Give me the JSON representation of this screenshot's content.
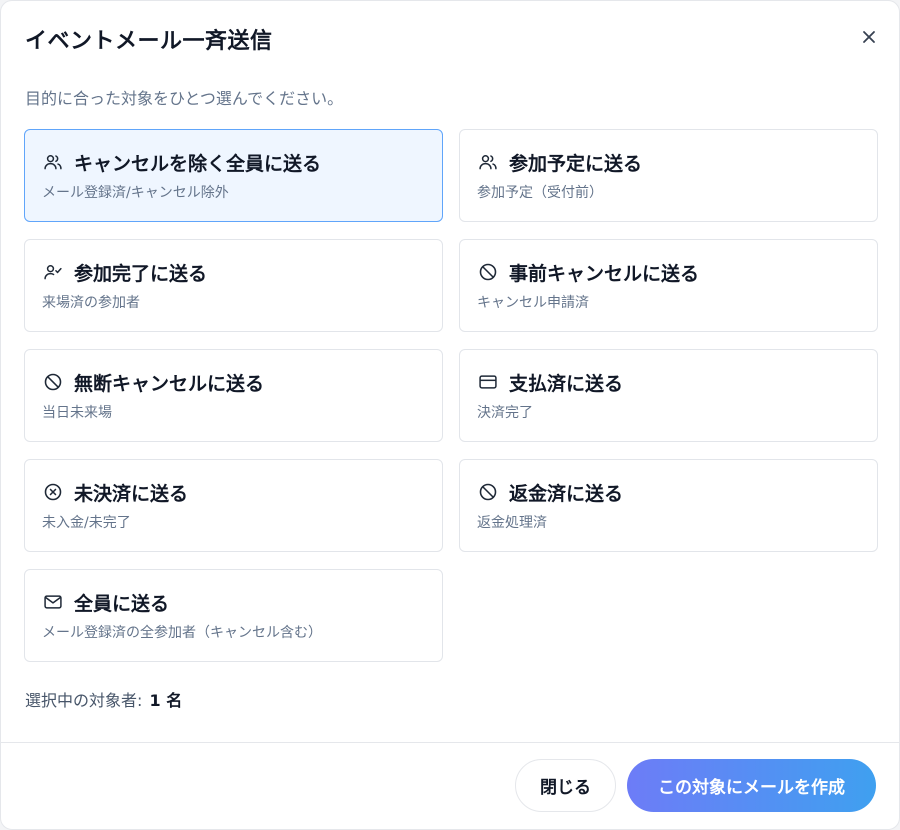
{
  "dialog": {
    "title": "イベントメール一斉送信",
    "close_icon": "close-icon"
  },
  "subtitle": "目的に合った対象をひとつ選んでください。",
  "options": [
    {
      "title": "キャンセルを除く全員に送る",
      "desc": "メール登録済/キャンセル除外",
      "icon": "users-icon",
      "selected": true
    },
    {
      "title": "参加予定に送る",
      "desc": "参加予定（受付前）",
      "icon": "users-icon",
      "selected": false
    },
    {
      "title": "参加完了に送る",
      "desc": "来場済の参加者",
      "icon": "user-check-icon",
      "selected": false
    },
    {
      "title": "事前キャンセルに送る",
      "desc": "キャンセル申請済",
      "icon": "ban-icon",
      "selected": false
    },
    {
      "title": "無断キャンセルに送る",
      "desc": "当日未来場",
      "icon": "ban-icon",
      "selected": false
    },
    {
      "title": "支払済に送る",
      "desc": "決済完了",
      "icon": "credit-card-icon",
      "selected": false
    },
    {
      "title": "未決済に送る",
      "desc": "未入金/未完了",
      "icon": "x-circle-icon",
      "selected": false
    },
    {
      "title": "返金済に送る",
      "desc": "返金処理済",
      "icon": "ban-icon",
      "selected": false
    },
    {
      "title": "全員に送る",
      "desc": "メール登録済の全参加者（キャンセル含む）",
      "icon": "mail-icon",
      "selected": false
    }
  ],
  "count": {
    "label": "選択中の対象者:",
    "value": "1 名"
  },
  "footer": {
    "close_label": "閉じる",
    "create_label": "この対象にメールを作成"
  },
  "colors": {
    "selected_bg": "#eff6ff",
    "selected_border": "#60a5fa",
    "primary_gradient_start": "#6d7cf7",
    "primary_gradient_end": "#3fa0f0"
  }
}
